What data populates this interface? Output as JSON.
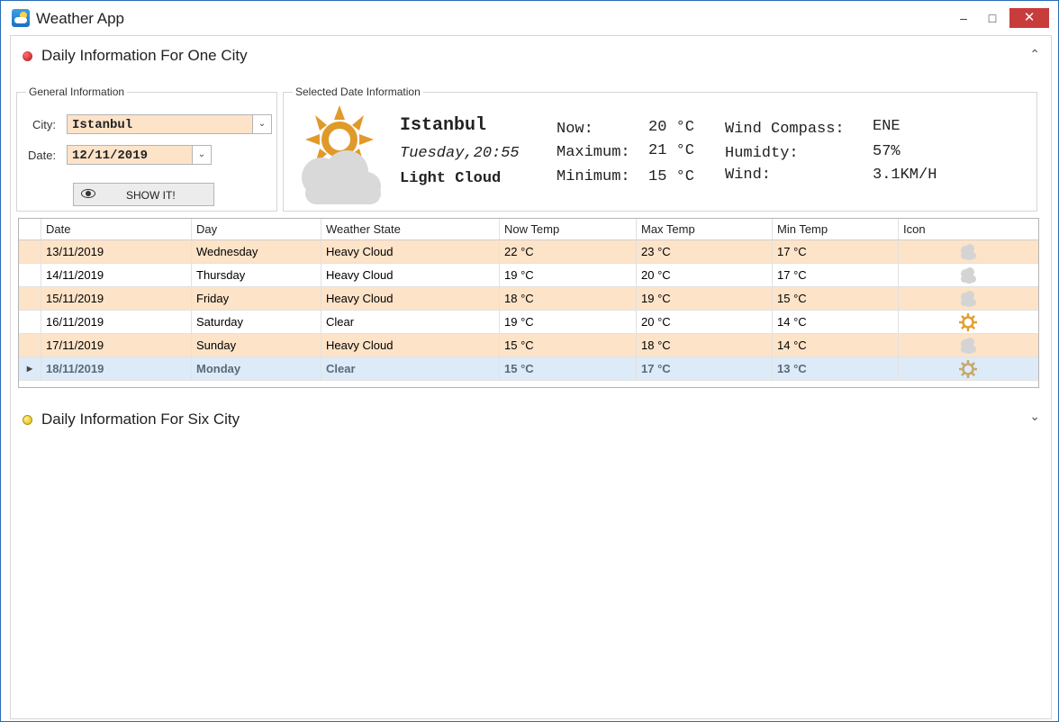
{
  "window": {
    "title": "Weather App",
    "buttons": {
      "minimize": "‒",
      "maximize": "□",
      "close": "✕"
    }
  },
  "section_one": {
    "title": "Daily Information For One City",
    "expanded": true,
    "general": {
      "legend": "General Information",
      "city_label": "City:",
      "city_value": "Istanbul",
      "date_label": "Date:",
      "date_value": "12/11/2019",
      "show_button": "SHOW IT!"
    },
    "selected": {
      "legend": "Selected Date Information",
      "city": "Istanbul",
      "date_time": "Tuesday,20:55",
      "state": "Light Cloud",
      "now_label": "Now:",
      "now_value": "20 °C",
      "max_label": "Maximum:",
      "max_value": "21 °C",
      "min_label": "Minimum:",
      "min_value": "15 °C",
      "wind_compass_label": "Wind Compass:",
      "wind_compass_value": "ENE",
      "humidity_label": "Humidty:",
      "humidity_value": "57%",
      "wind_label": "Wind:",
      "wind_value": "3.1KM/H"
    },
    "grid": {
      "columns": [
        "Date",
        "Day",
        "Weather State",
        "Now Temp",
        "Max Temp",
        "Min Temp",
        "Icon"
      ],
      "rows": [
        [
          "13/11/2019",
          "Wednesday",
          "Heavy Cloud",
          "22 °C",
          "23 °C",
          "17 °C",
          "cloud-icon"
        ],
        [
          "14/11/2019",
          "Thursday",
          "Heavy Cloud",
          "19 °C",
          "20 °C",
          "17 °C",
          "cloud-icon"
        ],
        [
          "15/11/2019",
          "Friday",
          "Heavy Cloud",
          "18 °C",
          "19 °C",
          "15 °C",
          "cloud-icon"
        ],
        [
          "16/11/2019",
          "Saturday",
          "Clear",
          "19 °C",
          "20 °C",
          "14 °C",
          "sun-icon"
        ],
        [
          "17/11/2019",
          "Sunday",
          "Heavy Cloud",
          "15 °C",
          "18 °C",
          "14 °C",
          "cloud-icon"
        ],
        [
          "18/11/2019",
          "Monday",
          "Clear",
          "15 °C",
          "17 °C",
          "13 °C",
          "sun-icon"
        ]
      ],
      "selected_row": 5
    }
  },
  "section_two": {
    "title": "Daily Information For Six City",
    "expanded": false
  },
  "colors": {
    "alt_row": "#fde3c8",
    "selected_row": "#dcebf7",
    "close_button": "#c83c3c",
    "sun": "#e0a030"
  }
}
